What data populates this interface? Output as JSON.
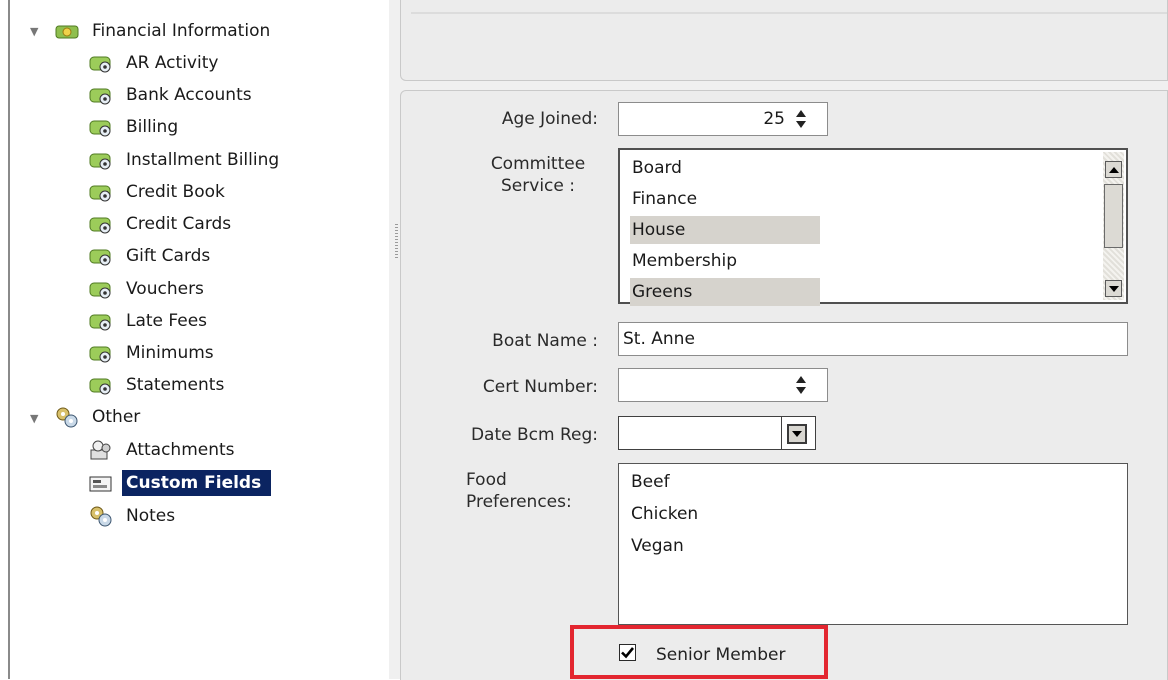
{
  "tree": {
    "groups": [
      {
        "label": "Financial Information",
        "icon": "money-icon",
        "expanded": true,
        "items": [
          {
            "label": "AR Activity",
            "icon": "money-icon"
          },
          {
            "label": "Bank Accounts",
            "icon": "money-icon"
          },
          {
            "label": "Billing",
            "icon": "money-icon"
          },
          {
            "label": "Installment Billing",
            "icon": "money-icon"
          },
          {
            "label": "Credit Book",
            "icon": "money-icon"
          },
          {
            "label": "Credit Cards",
            "icon": "money-icon"
          },
          {
            "label": "Gift Cards",
            "icon": "money-icon"
          },
          {
            "label": "Vouchers",
            "icon": "money-icon"
          },
          {
            "label": "Late Fees",
            "icon": "money-icon"
          },
          {
            "label": "Minimums",
            "icon": "money-icon"
          },
          {
            "label": "Statements",
            "icon": "money-icon"
          }
        ]
      },
      {
        "label": "Other",
        "icon": "gears-icon",
        "expanded": true,
        "items": [
          {
            "label": "Attachments",
            "icon": "attachment-icon"
          },
          {
            "label": "Custom Fields",
            "icon": "custom-fields-icon",
            "selected": true
          },
          {
            "label": "Notes",
            "icon": "gears-icon"
          }
        ]
      }
    ]
  },
  "form": {
    "age_joined": {
      "label": "Age Joined:",
      "value": "25"
    },
    "committee_service": {
      "label": "Committee Service :",
      "options": [
        "Board",
        "Finance",
        "House",
        "Membership",
        "Greens"
      ],
      "selected": [
        "House",
        "Greens"
      ]
    },
    "boat_name": {
      "label": "Boat Name :",
      "value": "St. Anne"
    },
    "cert_number": {
      "label": "Cert Number:",
      "value": ""
    },
    "date_bcm_reg": {
      "label": "Date Bcm Reg:",
      "value": ""
    },
    "food_preferences": {
      "label": "Food Preferences:",
      "options": [
        "Beef",
        "Chicken",
        "Vegan"
      ]
    },
    "senior_member": {
      "label": "Senior Member",
      "checked": true
    }
  },
  "colors": {
    "selection_bg": "#0b2461",
    "highlight_border": "#e32630",
    "list_highlight": "#d6d3cd"
  }
}
